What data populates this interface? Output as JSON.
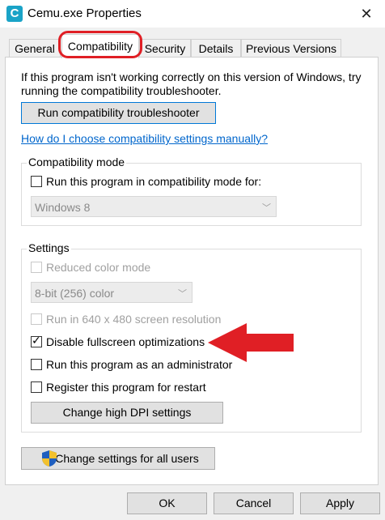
{
  "window": {
    "title": "Cemu.exe Properties",
    "icon_letter": "C",
    "close_glyph": "✕"
  },
  "tabs": [
    {
      "label": "General"
    },
    {
      "label": "Compatibility"
    },
    {
      "label": "Security"
    },
    {
      "label": "Details"
    },
    {
      "label": "Previous Versions"
    }
  ],
  "intro": {
    "line1": "If this program isn't working correctly on this version of Windows, try",
    "line2": "running the compatibility troubleshooter."
  },
  "buttons": {
    "troubleshooter": "Run compatibility troubleshooter",
    "high_dpi": "Change high DPI settings",
    "all_users": "Change settings for all users",
    "ok": "OK",
    "cancel": "Cancel",
    "apply": "Apply"
  },
  "help_link": "How do I choose compatibility settings manually?",
  "compat_mode": {
    "group_label": "Compatibility mode",
    "checkbox_label": "Run this program in compatibility mode for:",
    "checked": false,
    "os_select": "Windows 8"
  },
  "settings": {
    "group_label": "Settings",
    "reduced_color": {
      "label": "Reduced color mode",
      "checked": false,
      "disabled": true
    },
    "color_select": "8-bit (256) color",
    "res_640": {
      "label": "Run in 640 x 480 screen resolution",
      "checked": false,
      "disabled": true
    },
    "fullscreen_opt": {
      "label": "Disable fullscreen optimizations",
      "checked": true
    },
    "run_admin": {
      "label": "Run this program as an administrator",
      "checked": false
    },
    "register_restart": {
      "label": "Register this program for restart",
      "checked": false
    }
  },
  "colors": {
    "annotation_red": "#e01f25",
    "link_blue": "#0066cc",
    "focus_blue": "#0078d7"
  },
  "icons": {
    "app": "cemu-app-icon",
    "shield": "uac-shield-icon",
    "annotation": "red-arrow-icon"
  }
}
